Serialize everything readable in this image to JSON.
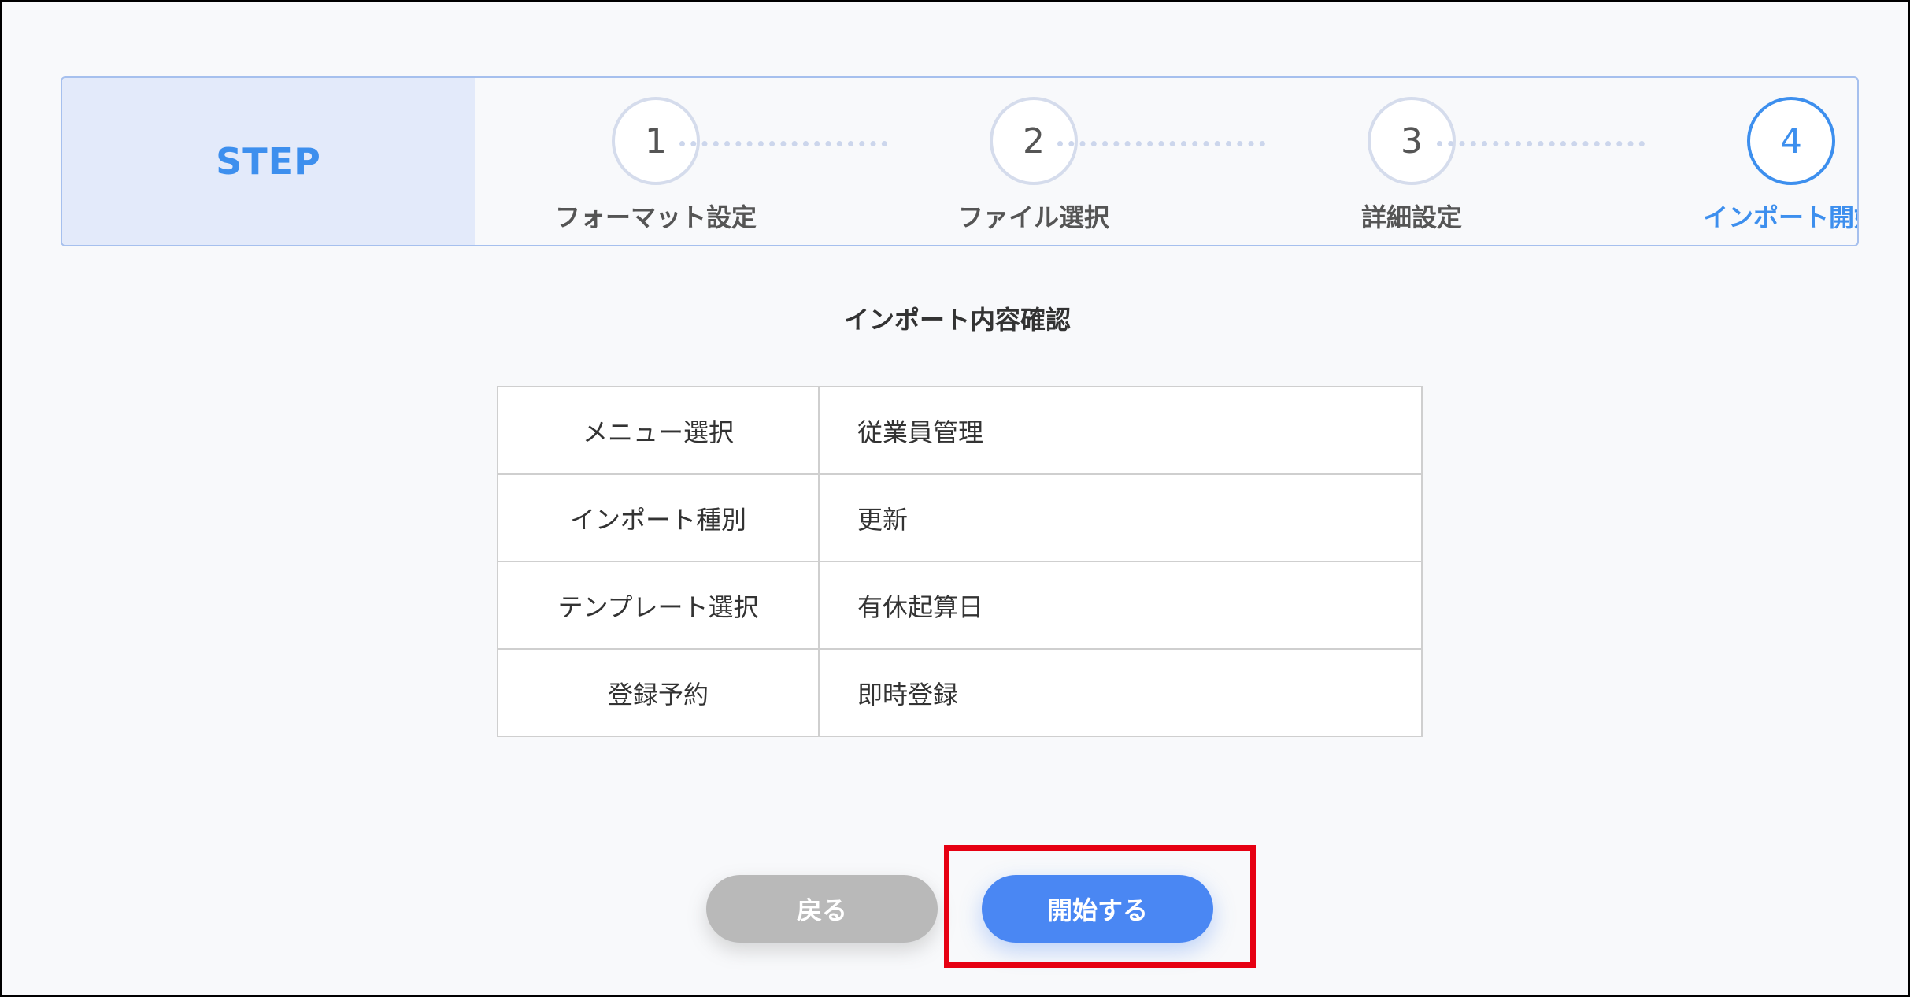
{
  "step_bar": {
    "label": "STEP",
    "steps": [
      {
        "number": "1",
        "name": "フォーマット設定",
        "active": false
      },
      {
        "number": "2",
        "name": "ファイル選択",
        "active": false
      },
      {
        "number": "3",
        "name": "詳細設定",
        "active": false
      },
      {
        "number": "4",
        "name": "インポート開始",
        "active": true
      }
    ]
  },
  "section_title": "インポート内容確認",
  "summary": {
    "rows": [
      {
        "label": "メニュー選択",
        "value": "従業員管理"
      },
      {
        "label": "インポート種別",
        "value": "更新"
      },
      {
        "label": "テンプレート選択",
        "value": "有休起算日"
      },
      {
        "label": "登録予約",
        "value": "即時登録"
      }
    ]
  },
  "buttons": {
    "back_label": "戻る",
    "start_label": "開始する"
  },
  "colors": {
    "accent": "#3d8fee",
    "start_button": "#4a87f3",
    "back_button": "#b9b9b9",
    "highlight": "#e60012"
  }
}
